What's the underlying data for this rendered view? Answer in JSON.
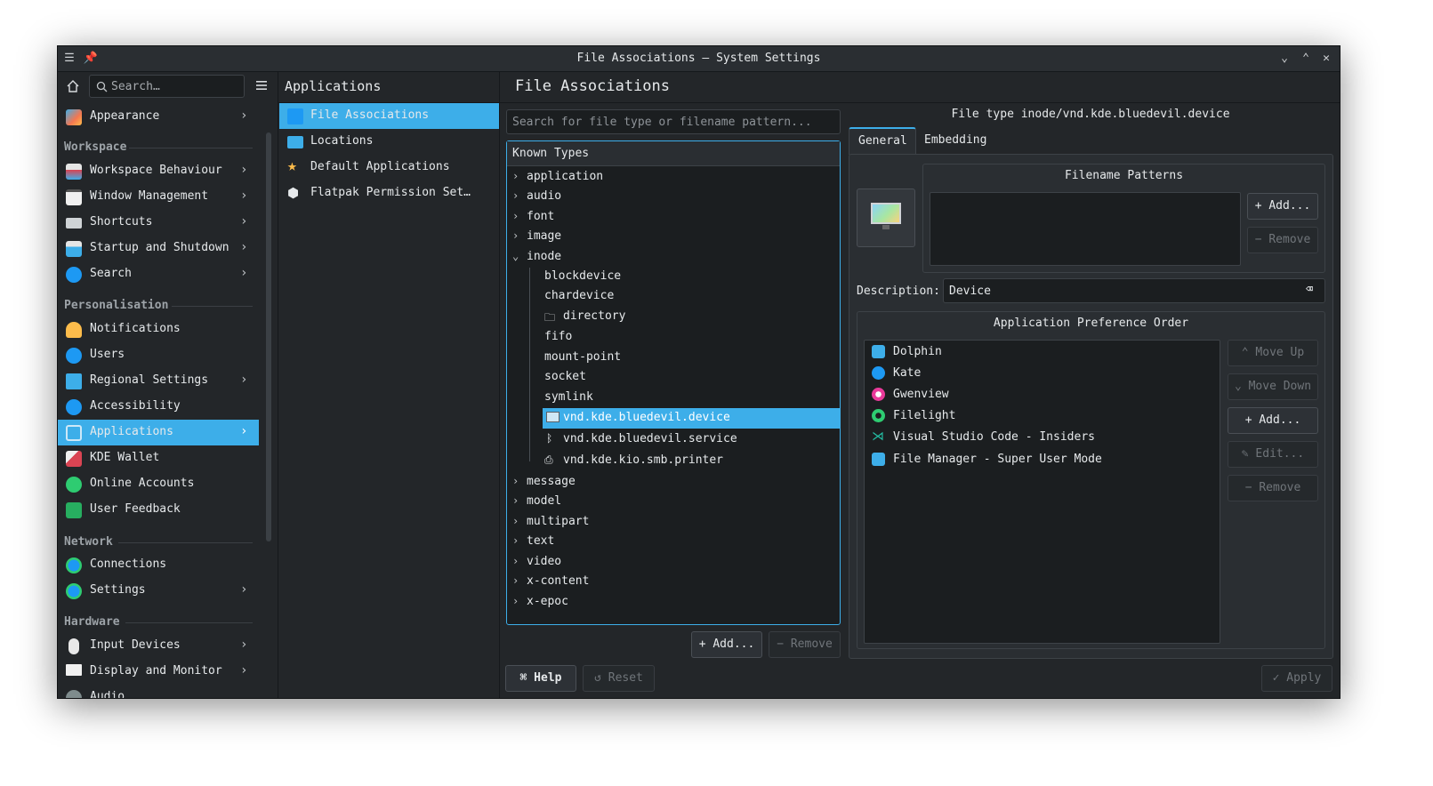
{
  "window": {
    "title": "File Associations — System Settings"
  },
  "sidebar": {
    "search_placeholder": "Search…",
    "top_item": {
      "label": "Appearance"
    },
    "sections": [
      {
        "heading": "Workspace",
        "items": [
          "Workspace Behaviour",
          "Window Management",
          "Shortcuts",
          "Startup and Shutdown",
          "Search"
        ]
      },
      {
        "heading": "Personalisation",
        "items": [
          "Notifications",
          "Users",
          "Regional Settings",
          "Accessibility",
          "Applications",
          "KDE Wallet",
          "Online Accounts",
          "User Feedback"
        ]
      },
      {
        "heading": "Network",
        "items": [
          "Connections",
          "Settings"
        ]
      },
      {
        "heading": "Hardware",
        "items": [
          "Input Devices",
          "Display and Monitor",
          "Audio"
        ]
      }
    ]
  },
  "subpanel": {
    "title": "Applications",
    "items": [
      "File Associations",
      "Locations",
      "Default Applications",
      "Flatpak Permission Set…"
    ]
  },
  "main": {
    "title": "File Associations",
    "search_placeholder": "Search for file type or filename pattern...",
    "tree_header": "Known Types",
    "tree_top": [
      "application",
      "audio",
      "font",
      "image",
      "inode"
    ],
    "inode_children": [
      "blockdevice",
      "chardevice",
      "directory",
      "fifo",
      "mount-point",
      "socket",
      "symlink",
      "vnd.kde.bluedevil.device",
      "vnd.kde.bluedevil.service",
      "vnd.kde.kio.smb.printer"
    ],
    "tree_bottom": [
      "message",
      "model",
      "multipart",
      "text",
      "video",
      "x-content",
      "x-epoc"
    ],
    "add_label": "Add...",
    "remove_label": "Remove",
    "help_label": "Help",
    "reset_label": "Reset",
    "apply_label": "Apply"
  },
  "details": {
    "file_type": "File type inode/vnd.kde.bluedevil.device",
    "tabs": [
      "General",
      "Embedding"
    ],
    "filename_patterns_title": "Filename Patterns",
    "add_label": "Add...",
    "remove_label": "Remove",
    "description_label": "Description:",
    "description_value": "Device",
    "app_pref_title": "Application Preference Order",
    "apps": [
      "Dolphin",
      "Kate",
      "Gwenview",
      "Filelight",
      "Visual Studio Code - Insiders",
      "File Manager - Super User Mode"
    ],
    "move_up_label": "Move Up",
    "move_down_label": "Move Down",
    "edit_label": "Edit...",
    "accent": "#3daee9"
  }
}
